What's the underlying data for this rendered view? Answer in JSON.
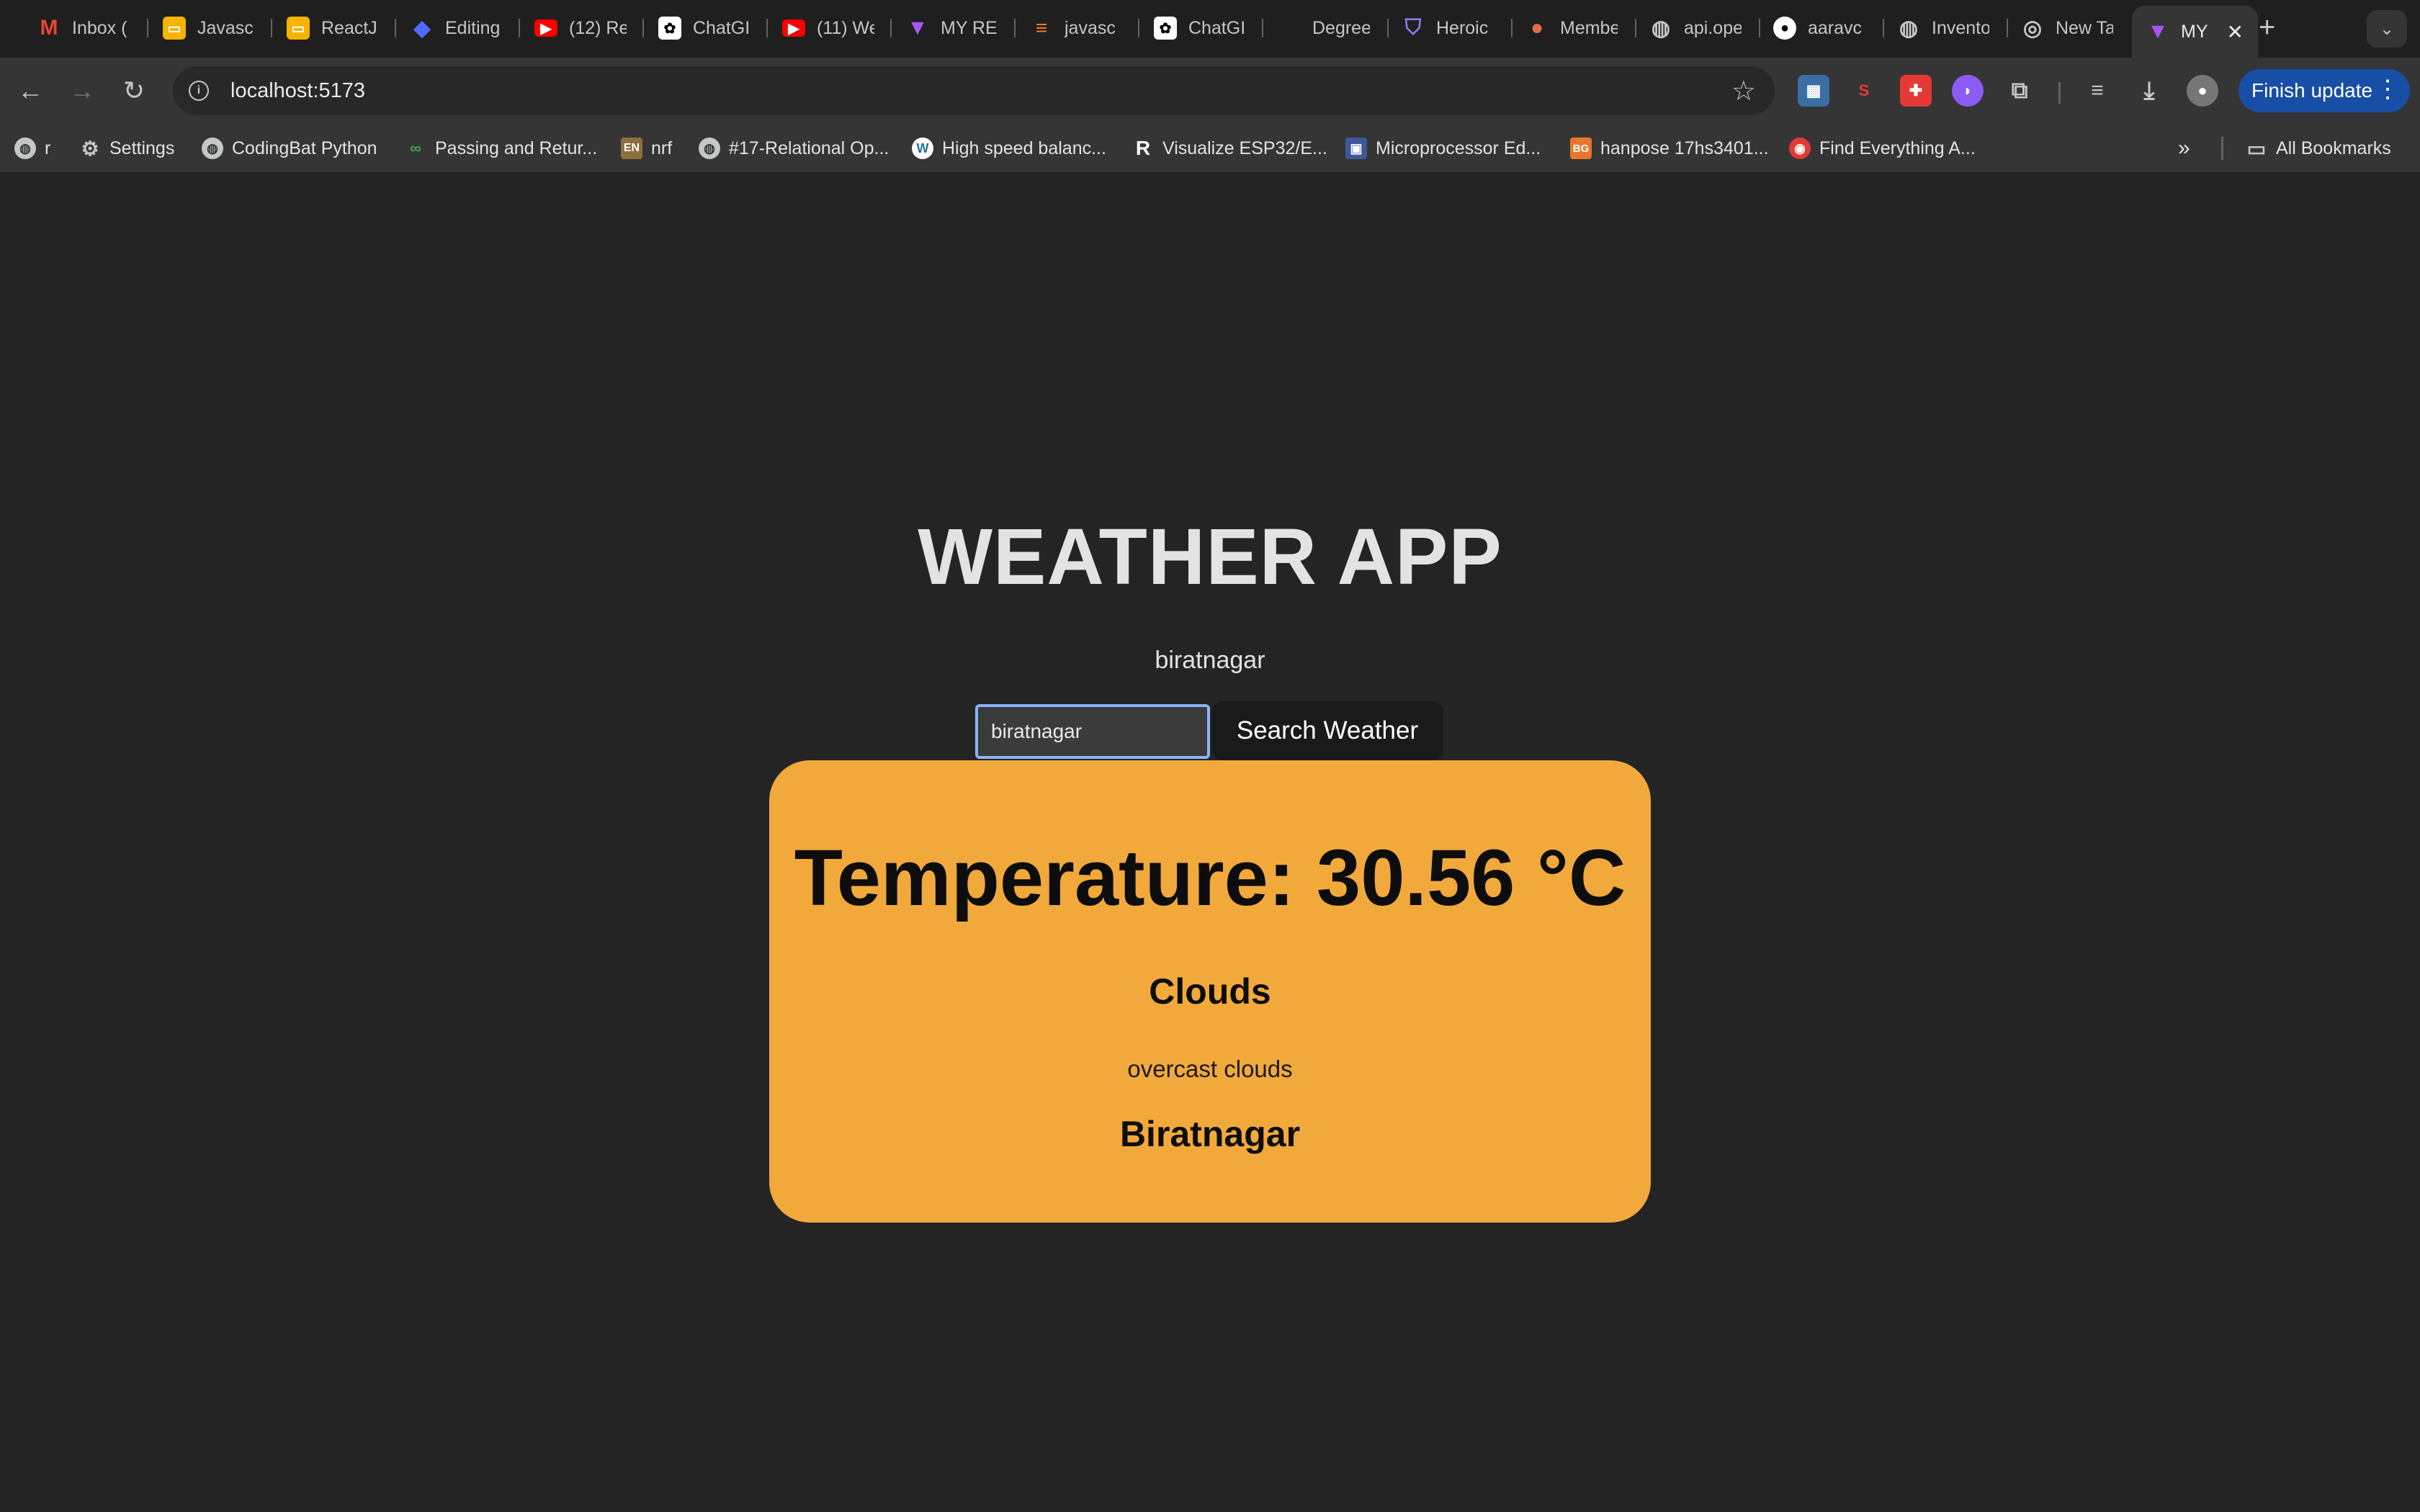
{
  "browser": {
    "tabs": [
      {
        "title": "Inbox (",
        "icon": "gmail-icon"
      },
      {
        "title": "Javasc",
        "icon": "slides-icon"
      },
      {
        "title": "ReactJ",
        "icon": "slides-icon"
      },
      {
        "title": "Editing",
        "icon": "diamond-icon"
      },
      {
        "title": "(12) Re",
        "icon": "youtube-icon"
      },
      {
        "title": "ChatGI",
        "icon": "chatgpt-icon"
      },
      {
        "title": "(11) We",
        "icon": "youtube-icon"
      },
      {
        "title": "MY RE",
        "icon": "vite-icon"
      },
      {
        "title": "javasc",
        "icon": "stackoverflow-icon"
      },
      {
        "title": "ChatGI",
        "icon": "chatgpt-icon"
      },
      {
        "title": "Degree",
        "icon": "blank-icon"
      },
      {
        "title": "Heroic",
        "icon": "shield-icon"
      },
      {
        "title": "Membe",
        "icon": "helmet-icon"
      },
      {
        "title": "api.ope",
        "icon": "globe-icon"
      },
      {
        "title": "aaravc",
        "icon": "github-icon"
      },
      {
        "title": "Invento",
        "icon": "globe-icon"
      },
      {
        "title": "New Ta",
        "icon": "chrome-icon"
      },
      {
        "title": "MY",
        "icon": "vite-icon"
      }
    ],
    "url": "localhost:5173",
    "finish_update": "Finish update",
    "bookmarks": [
      {
        "label": "r"
      },
      {
        "label": "Settings"
      },
      {
        "label": "CodingBat Python"
      },
      {
        "label": "Passing and Retur..."
      },
      {
        "label": "nrf"
      },
      {
        "label": "#17-Relational Op..."
      },
      {
        "label": "High speed balanc..."
      },
      {
        "label": "Visualize ESP32/E..."
      },
      {
        "label": "Microprocessor Ed..."
      },
      {
        "label": "hanpose 17hs3401..."
      },
      {
        "label": "Find Everything A..."
      }
    ],
    "all_bookmarks": "All Bookmarks"
  },
  "app": {
    "title": "WEATHER APP",
    "city_echo": "biratnagar",
    "search": {
      "value": "biratnagar",
      "button": "Search Weather"
    },
    "weather": {
      "temperature": "Temperature: 30.56 °C",
      "main": "Clouds",
      "description": "overcast clouds",
      "city": "Biratnagar"
    }
  },
  "colors": {
    "page_bg": "#242424",
    "card_bg": "#f2a93b",
    "focus_ring": "#8ab4f8",
    "update_button": "#174ea6"
  }
}
